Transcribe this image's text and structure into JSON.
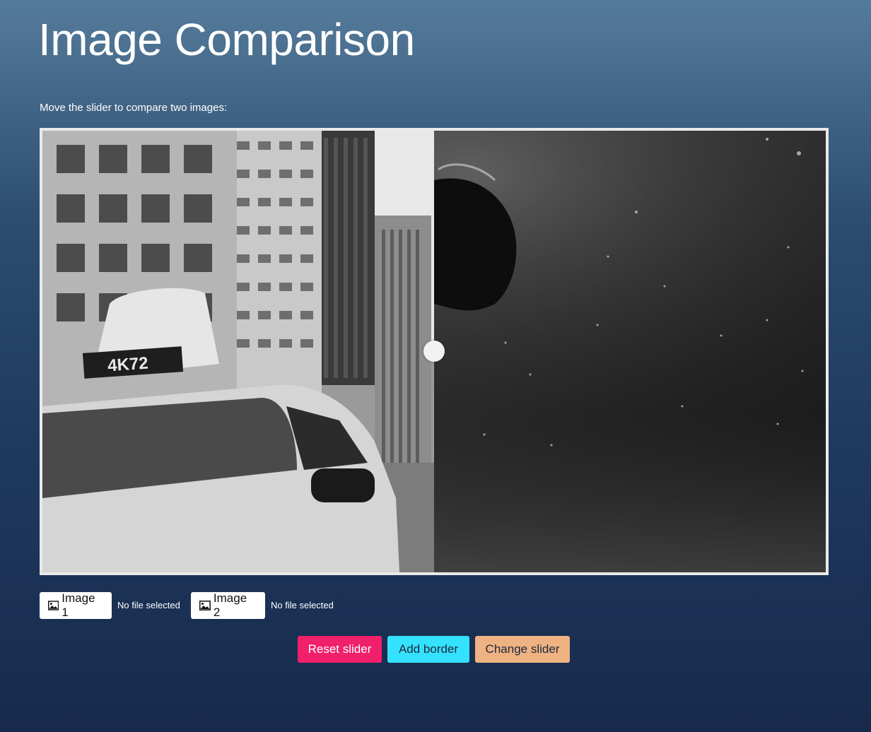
{
  "page": {
    "title": "Image Comparison",
    "instructions": "Move the slider to compare two images:"
  },
  "comparison": {
    "left_image_icon": "city-taxi-photo",
    "right_image_icon": "underwater-photo",
    "taxi_sign_text": "4K72",
    "slider_position": 0.5
  },
  "file_inputs": [
    {
      "label": "Image 1",
      "status": "No file selected",
      "icon": "image-icon"
    },
    {
      "label": "Image 2",
      "status": "No file selected",
      "icon": "image-icon"
    }
  ],
  "actions": {
    "reset_label": "Reset slider",
    "border_label": "Add border",
    "change_label": "Change slider"
  },
  "colors": {
    "reset": "#f0206b",
    "border": "#34e2ff",
    "change": "#efb283",
    "frame": "#e9e9ea"
  }
}
